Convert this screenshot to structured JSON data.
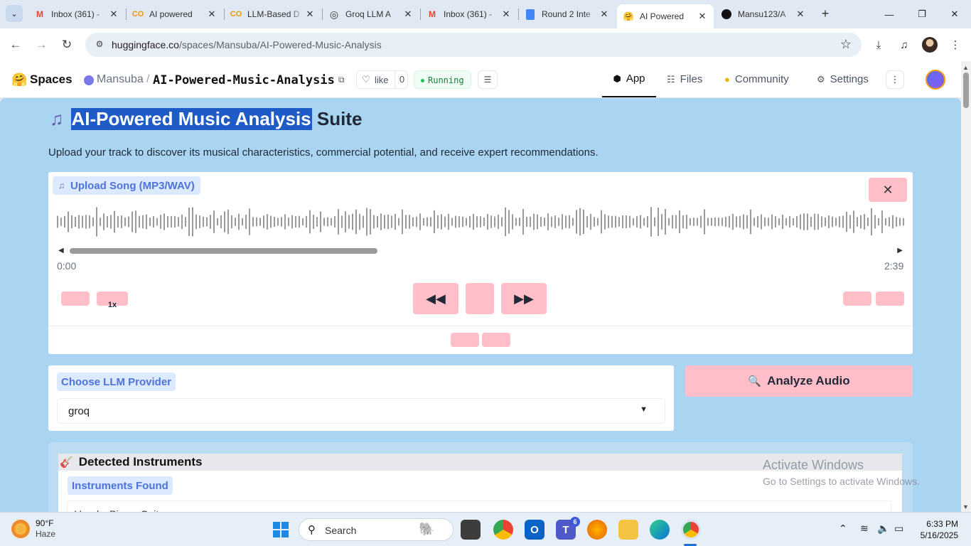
{
  "browser": {
    "tabs": [
      {
        "title": "Inbox (361) - ",
        "icon": "gmail-icon"
      },
      {
        "title": "AI powered ",
        "icon": "colab-icon"
      },
      {
        "title": "LLM-Based D",
        "icon": "colab-icon"
      },
      {
        "title": "Groq LLM A",
        "icon": "openai-icon"
      },
      {
        "title": "Inbox (361) - ",
        "icon": "gmail-icon"
      },
      {
        "title": "Round 2 Inte",
        "icon": "docs-icon"
      },
      {
        "title": "AI Powered ",
        "icon": "huggingface-icon"
      },
      {
        "title": "Mansu123/A",
        "icon": "github-icon"
      }
    ],
    "url_host": "huggingface.co",
    "url_path": "/spaces/Mansuba/AI-Powered-Music-Analysis"
  },
  "hf_header": {
    "brand": "Spaces",
    "owner": "Mansuba",
    "separator": "/",
    "repo": "AI-Powered-Music-Analysis",
    "like_label": "like",
    "like_count": "0",
    "status": "Running",
    "nav": [
      {
        "label": "App",
        "icon": "cube-icon"
      },
      {
        "label": "Files",
        "icon": "files-icon"
      },
      {
        "label": "Community",
        "icon": "community-icon"
      },
      {
        "label": "Settings",
        "icon": "gear-icon"
      }
    ]
  },
  "app": {
    "title_highlighted": "AI-Powered Music Analysis",
    "title_rest": " Suite",
    "subtitle": "Upload your track to discover its musical characteristics, commercial potential, and receive expert recommendations.",
    "upload_label": "Upload Song (MP3/WAV)",
    "time_start": "0:00",
    "time_end": "2:39",
    "playback_rate": "1x",
    "llm_label": "Choose LLM Provider",
    "llm_selected": "groq",
    "analyze_label": "Analyze Audio",
    "instruments_heading": "Detected Instruments",
    "instruments_label": "Instruments Found",
    "instruments_value": "Vocals, Piano, Guitar"
  },
  "os": {
    "watermark_line1": "Activate Windows",
    "watermark_line2": "Go to Settings to activate Windows.",
    "weather_temp": "90°F",
    "weather_cond": "Haze",
    "search_placeholder": "Search",
    "teams_badge": "6",
    "time": "6:33 PM",
    "date": "5/16/2025"
  },
  "colors": {
    "app_bg": "#a9d4f2",
    "button_pink": "#ffbec8",
    "label_blue": "#4f72d9",
    "title_highlight": "#1e5bc6"
  }
}
